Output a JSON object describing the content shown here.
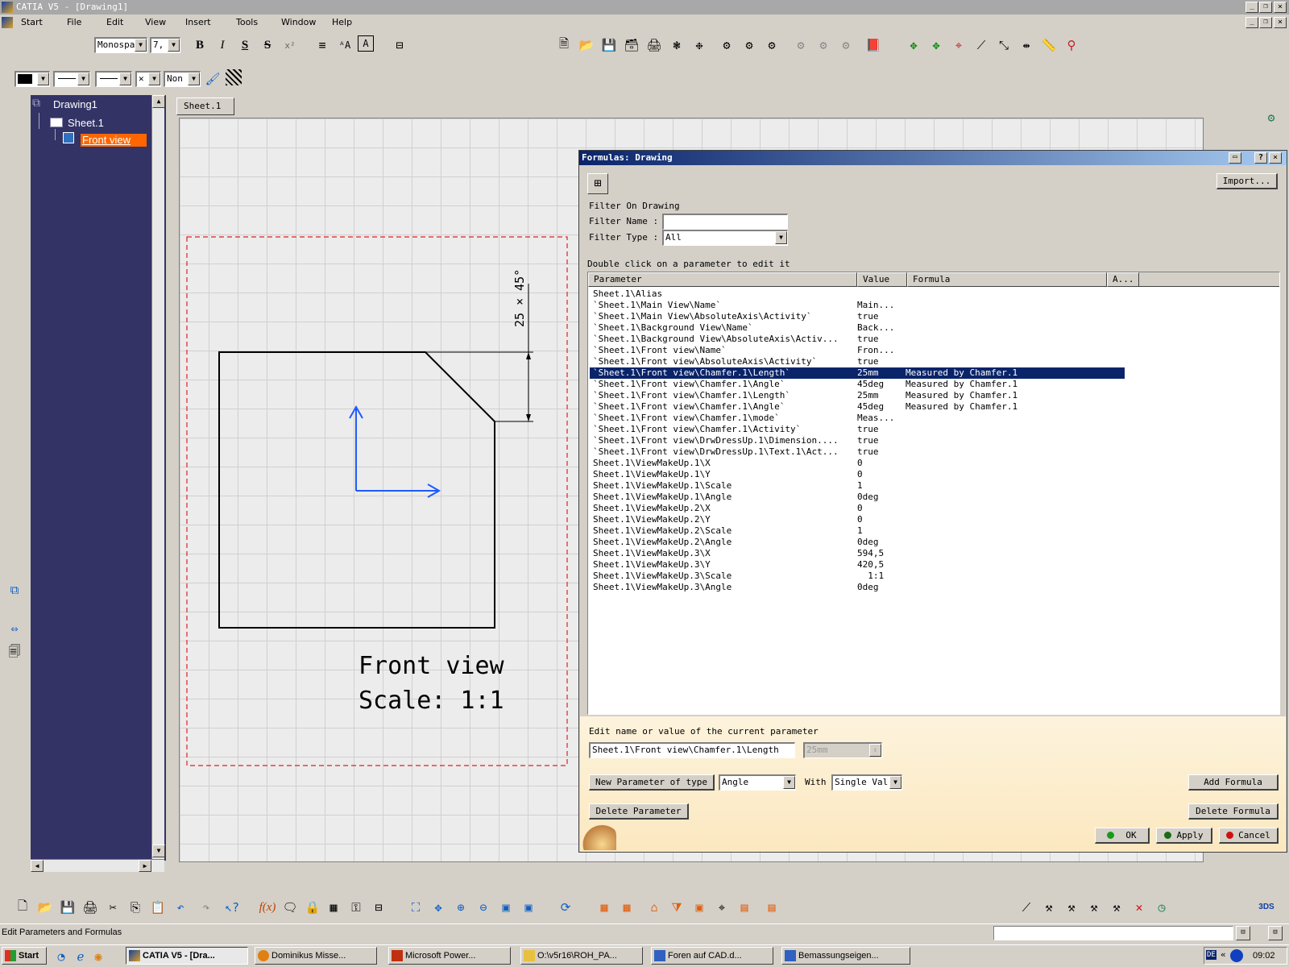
{
  "window": {
    "title": "CATIA V5 - [Drawing1]"
  },
  "menu": [
    "Start",
    "File",
    "Edit",
    "View",
    "Insert",
    "Tools",
    "Window",
    "Help"
  ],
  "text_toolbar": {
    "font": "Monospa",
    "size": "7,",
    "bold": "B",
    "italic": "I",
    "underline": "S",
    "strike": "S",
    "superscript": "x²"
  },
  "graphic_toolbar": {
    "linetype_none": "Non"
  },
  "tree": {
    "root": "Drawing1",
    "sheet": "Sheet.1",
    "view": "Front view"
  },
  "sheet_tab": "Sheet.1",
  "drawing": {
    "chamfer_label": "25 × 45°",
    "view_name": "Front view",
    "scale": "Scale:  1:1"
  },
  "dialog": {
    "title": "Formulas: Drawing",
    "import_button": "Import...",
    "filter_on": "Filter On Drawing",
    "filter_name_label": "Filter Name :",
    "filter_name_value": "",
    "filter_type_label": "Filter Type :",
    "filter_type_value": "All",
    "instruction": "Double click on a parameter to edit it",
    "columns": [
      "Parameter",
      "Value",
      "Formula",
      "A..."
    ],
    "rows": [
      {
        "p": "Sheet.1\\Alias",
        "v": "",
        "f": ""
      },
      {
        "p": "`Sheet.1\\Main View\\Name`",
        "v": "Main...",
        "f": ""
      },
      {
        "p": "`Sheet.1\\Main View\\AbsoluteAxis\\Activity`",
        "v": "true",
        "f": ""
      },
      {
        "p": "`Sheet.1\\Background View\\Name`",
        "v": "Back...",
        "f": ""
      },
      {
        "p": "`Sheet.1\\Background View\\AbsoluteAxis\\Activ...",
        "v": "true",
        "f": ""
      },
      {
        "p": "`Sheet.1\\Front view\\Name`",
        "v": "Fron...",
        "f": ""
      },
      {
        "p": "`Sheet.1\\Front view\\AbsoluteAxis\\Activity`",
        "v": "true",
        "f": ""
      },
      {
        "p": "`Sheet.1\\Front view\\Chamfer.1\\Length`",
        "v": "25mm",
        "f": "Measured by Chamfer.1",
        "selected": true
      },
      {
        "p": "`Sheet.1\\Front view\\Chamfer.1\\Angle`",
        "v": "45deg",
        "f": "Measured by Chamfer.1"
      },
      {
        "p": "`Sheet.1\\Front view\\Chamfer.1\\Length`",
        "v": "25mm",
        "f": "Measured by Chamfer.1"
      },
      {
        "p": "`Sheet.1\\Front view\\Chamfer.1\\Angle`",
        "v": "45deg",
        "f": "Measured by Chamfer.1"
      },
      {
        "p": "`Sheet.1\\Front view\\Chamfer.1\\mode`",
        "v": "Meas...",
        "f": ""
      },
      {
        "p": "`Sheet.1\\Front view\\Chamfer.1\\Activity`",
        "v": "true",
        "f": ""
      },
      {
        "p": "`Sheet.1\\Front view\\DrwDressUp.1\\Dimension....",
        "v": "true",
        "f": ""
      },
      {
        "p": "`Sheet.1\\Front view\\DrwDressUp.1\\Text.1\\Act...",
        "v": "true",
        "f": ""
      },
      {
        "p": "Sheet.1\\ViewMakeUp.1\\X",
        "v": "0",
        "f": ""
      },
      {
        "p": "Sheet.1\\ViewMakeUp.1\\Y",
        "v": "0",
        "f": ""
      },
      {
        "p": "Sheet.1\\ViewMakeUp.1\\Scale",
        "v": "1",
        "f": ""
      },
      {
        "p": "Sheet.1\\ViewMakeUp.1\\Angle",
        "v": "0deg",
        "f": ""
      },
      {
        "p": "Sheet.1\\ViewMakeUp.2\\X",
        "v": "0",
        "f": ""
      },
      {
        "p": "Sheet.1\\ViewMakeUp.2\\Y",
        "v": "0",
        "f": ""
      },
      {
        "p": "Sheet.1\\ViewMakeUp.2\\Scale",
        "v": "1",
        "f": ""
      },
      {
        "p": "Sheet.1\\ViewMakeUp.2\\Angle",
        "v": "0deg",
        "f": ""
      },
      {
        "p": "Sheet.1\\ViewMakeUp.3\\X",
        "v": "594,5",
        "f": ""
      },
      {
        "p": "Sheet.1\\ViewMakeUp.3\\Y",
        "v": "420,5",
        "f": ""
      },
      {
        "p": "Sheet.1\\ViewMakeUp.3\\Scale",
        "v": "  1:1",
        "f": ""
      },
      {
        "p": "Sheet.1\\ViewMakeUp.3\\Angle",
        "v": "0deg",
        "f": ""
      }
    ],
    "edit_label": "Edit name or value of the current parameter",
    "edit_name": "Sheet.1\\Front view\\Chamfer.1\\Length",
    "edit_value": "25mm",
    "new_param_button": "New Parameter of type",
    "param_type": "Angle",
    "with_label": "With",
    "with_value": "Single Val",
    "add_formula": "Add Formula",
    "delete_parameter": "Delete Parameter",
    "delete_formula": "Delete Formula",
    "ok": "OK",
    "apply": "Apply",
    "cancel": "Cancel"
  },
  "status_bar": {
    "message": "Edit Parameters and Formulas"
  },
  "taskbar": {
    "start": "Start",
    "items": [
      "CATIA V5 - [Dra...",
      "Dominikus Misse...",
      "Microsoft Power...",
      "O:\\v5r16\\ROH_PA...",
      "Foren auf CAD.d...",
      "Bemassungseigen..."
    ],
    "lang": "DE",
    "clock": "09:02"
  },
  "colors": {
    "title_bar": "#0a246a",
    "tree_bg": "#333366",
    "highlight": "#ff6600",
    "dialog_bottom": "#fdf3dc",
    "axis_blue": "#1e5aff",
    "frame_red": "#e02020"
  }
}
